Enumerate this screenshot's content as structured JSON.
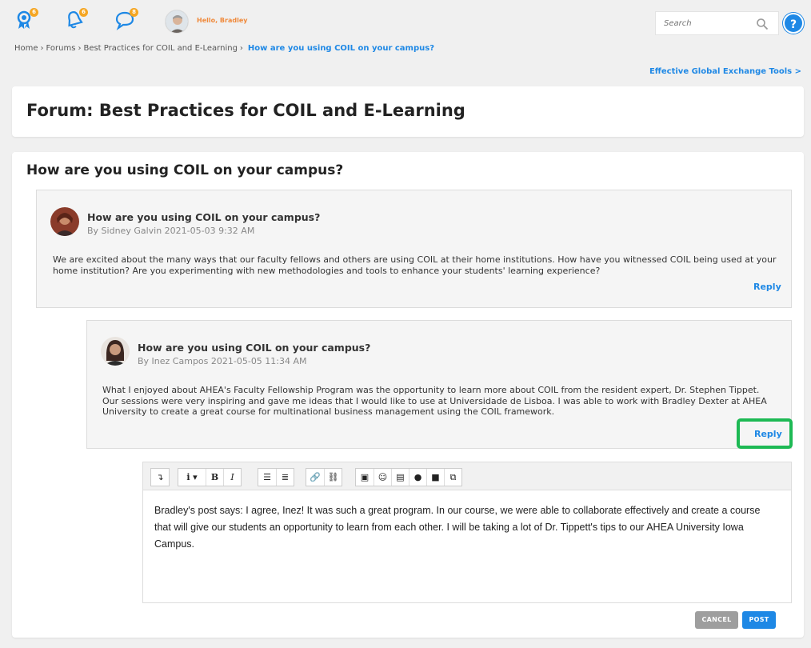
{
  "topbar": {
    "badges": {
      "awards": "6",
      "notifications": "6",
      "messages": "8"
    },
    "greeting": "Hello, Bradley",
    "search_placeholder": "Search",
    "help": "?"
  },
  "breadcrumb": {
    "items": [
      "Home",
      "Forums",
      "Best Practices for COIL and E-Learning"
    ],
    "current": "How are you using COIL on your campus?"
  },
  "tools_link": "Effective Global Exchange Tools >",
  "forum_title": "Forum: Best Practices for COIL and E-Learning",
  "thread_title": "How are you using COIL on your campus?",
  "posts": [
    {
      "title": "How are you using COIL on your campus?",
      "meta": "By Sidney Galvin 2021-05-03 9:32 AM",
      "body": "We are excited about the many ways that our faculty fellows and others are using COIL at their home institutions. How have you witnessed COIL being used at your home institution? Are you experimenting with new methodologies and tools to enhance your students' learning experience?",
      "reply": "Reply"
    },
    {
      "title": "How are you using COIL on your campus?",
      "meta": "By Inez Campos 2021-05-05 11:34 AM",
      "body": "What I enjoyed about AHEA's Faculty Fellowship Program was the opportunity to learn more about COIL from the resident expert, Dr. Stephen Tippet. Our sessions were very inspiring and gave me ideas that I would like to use at Universidade de Lisboa. I was able to work with Bradley Dexter at AHEA University to create a great course for multinational business management using the COIL framework.",
      "reply": "Reply"
    }
  ],
  "editor": {
    "content": "Bradley's post says: I agree, Inez! It was such a great program. In our course, we were able to collaborate effectively and create a course that will give our students an opportunity to learn from each other. I will be taking a lot of Dr. Tippett's tips to our AHEA University Iowa Campus.",
    "cancel": "CANCEL",
    "post": "POST"
  }
}
